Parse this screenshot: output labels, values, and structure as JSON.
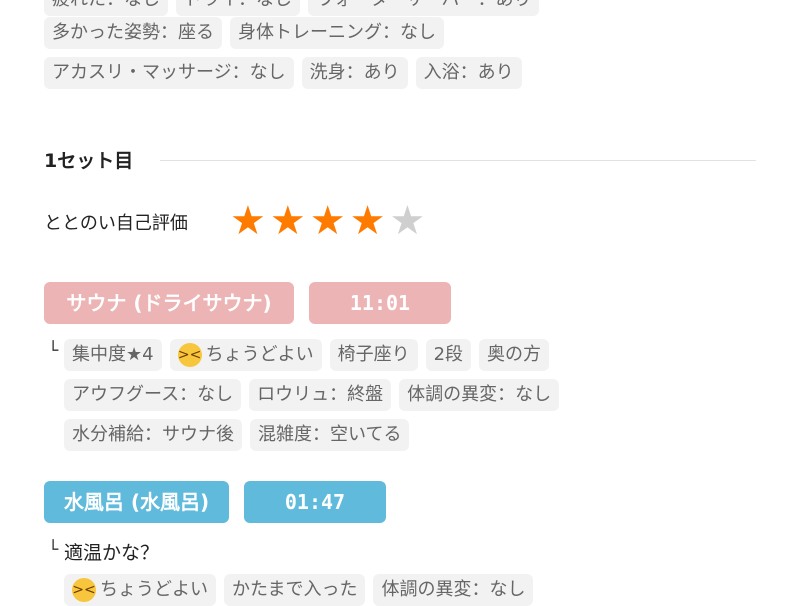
{
  "top_rows": {
    "row0": [
      "疲れた：なし",
      "ドライ：なし",
      "ウォーターサーバー：あり"
    ],
    "row1": [
      "多かった姿勢：座る",
      "身体トレーニング：なし"
    ],
    "row2": [
      "アカスリ・マッサージ：なし",
      "洗身：あり",
      "入浴：あり"
    ]
  },
  "set": {
    "title": "1セット目",
    "evaluation_label": "ととのい自己評価",
    "rating": 4,
    "rating_max": 5,
    "star_char": "★"
  },
  "sauna": {
    "label": "サウナ (ドライサウナ)",
    "time": "11:01",
    "branch_mark": "└",
    "tags_row1": [
      "集中度★4",
      "ちょうどよい",
      "椅子座り",
      "2段",
      "奥の方"
    ],
    "tags_row2": [
      "アウフグース：なし",
      "ロウリュ：終盤",
      "体調の異変：なし"
    ],
    "tags_row3": [
      "水分補給：サウナ後",
      "混雑度：空いてる"
    ]
  },
  "water": {
    "label": "水風呂 (水風呂)",
    "time": "01:47",
    "branch_mark": "└",
    "note": "適温かな？",
    "tags_row1": [
      "ちょうどよい",
      "かたまで入った",
      "体調の異変：なし"
    ]
  },
  "colors": {
    "star_on": "#ff7b00",
    "star_off": "#cfcfcf",
    "sauna_pill": "#ecb4b4",
    "water_pill": "#5fbadb",
    "tag_bg": "#f2f2f2"
  },
  "icons": {
    "emoji": "grinning-squint-face-icon"
  }
}
